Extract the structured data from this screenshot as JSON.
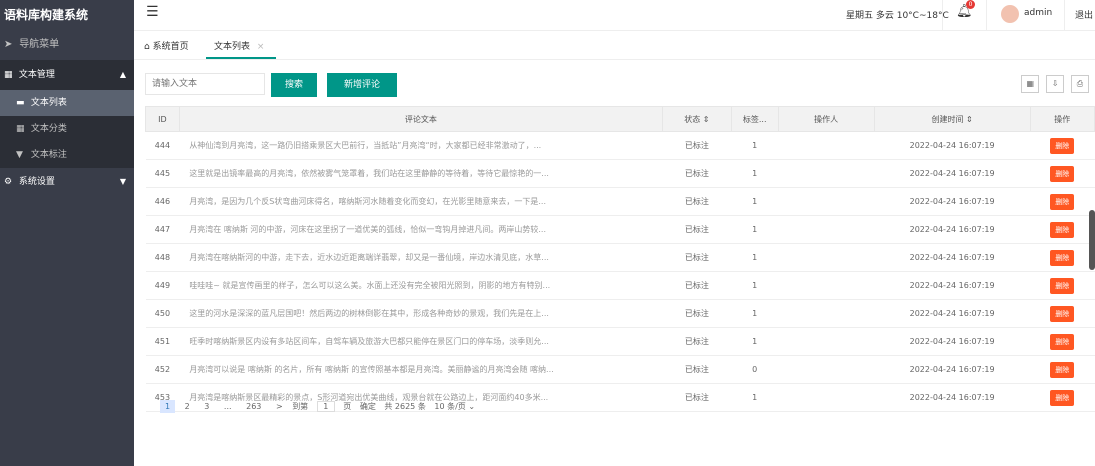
{
  "app_title": "语料库构建系统",
  "nav_label": "导航菜单",
  "menu": {
    "group1": "文本管理",
    "items": [
      "文本列表",
      "文本分类",
      "文本标注"
    ],
    "group2": "系统设置"
  },
  "header": {
    "weather": "星期五 多云 10°C~18°C",
    "badge": "0",
    "user": "admin",
    "logout": "退出"
  },
  "tabs": {
    "home": "系统首页",
    "active": "文本列表"
  },
  "toolbar": {
    "search_placeholder": "请输入文本",
    "search_btn": "搜索",
    "add_btn": "新增评论"
  },
  "table": {
    "headers": [
      "ID",
      "评论文本",
      "状态 ⇕",
      "标签...",
      "操作人",
      "创建时间 ⇕",
      "操作"
    ],
    "delete_label": "删除",
    "rows": [
      {
        "id": "444",
        "text": "从神仙湾到月亮湾，这一路仍旧搭乘景区大巴前行，当抵站”月亮湾“时，大家都已经非常激动了，...",
        "status": "已标注",
        "tag": "1",
        "op": "",
        "time": "2022-04-24 16:07:19"
      },
      {
        "id": "445",
        "text": "这里就是出镜率最高的月亮湾，依然被雾气笼罩着，我们站在这里静静的等待着，等待它最惊艳的一...",
        "status": "已标注",
        "tag": "1",
        "op": "",
        "time": "2022-04-24 16:07:19"
      },
      {
        "id": "446",
        "text": "月亮湾，是因为几个反S状弯曲河床得名，喀纳斯河水随着变化而变幻，在光影里随意来去，一下是...",
        "status": "已标注",
        "tag": "1",
        "op": "",
        "time": "2022-04-24 16:07:19"
      },
      {
        "id": "447",
        "text": "月亮湾在 喀纳斯 河的中游，河床在这里拐了一道优美的弧线，恰似一弯钩月掉进凡间。两岸山势较...",
        "status": "已标注",
        "tag": "1",
        "op": "",
        "time": "2022-04-24 16:07:19"
      },
      {
        "id": "448",
        "text": "月亮湾在喀纳斯河的中游，走下去，近水边近距离端详翡翠，却又是一番仙境，岸边水清见底，水草...",
        "status": "已标注",
        "tag": "1",
        "op": "",
        "time": "2022-04-24 16:07:19"
      },
      {
        "id": "449",
        "text": "哇哇哇~ 就是宣传画里的样子，怎么可以这么美。水面上还没有完全被阳光照到，阴影的地方有特别...",
        "status": "已标注",
        "tag": "1",
        "op": "",
        "time": "2022-04-24 16:07:19"
      },
      {
        "id": "450",
        "text": "这里的河水是深深的蓝凡层国吧！然后两边的树林倒影在其中，形成各种奇妙的景观，我们先是在上...",
        "status": "已标注",
        "tag": "1",
        "op": "",
        "time": "2022-04-24 16:07:19"
      },
      {
        "id": "451",
        "text": "旺季时喀纳斯景区内设有多站区间车，自驾车辆及旅游大巴都只能停在景区门口的停车场，淡季则允...",
        "status": "已标注",
        "tag": "1",
        "op": "",
        "time": "2022-04-24 16:07:19"
      },
      {
        "id": "452",
        "text": "月亮湾可以说是 喀纳斯 的名片，所有 喀纳斯 的宣传照基本都是月亮湾。美丽静谧的月亮湾会随 喀纳...",
        "status": "已标注",
        "tag": "0",
        "op": "",
        "time": "2022-04-24 16:07:19"
      },
      {
        "id": "453",
        "text": "月亮湾是喀纳斯景区最精彩的景点，S形河道宛出优美曲线，观景台就在公路边上，距河面约40多米...",
        "status": "已标注",
        "tag": "1",
        "op": "",
        "time": "2022-04-24 16:07:19"
      }
    ]
  },
  "pager": {
    "pages": [
      "1",
      "2",
      "3",
      "...",
      "263"
    ],
    "next": ">",
    "goto_label": "到第",
    "goto_value": "1",
    "page_unit": "页",
    "confirm": "确定",
    "total": "共 2625 条",
    "per_page": "10 条/页"
  }
}
